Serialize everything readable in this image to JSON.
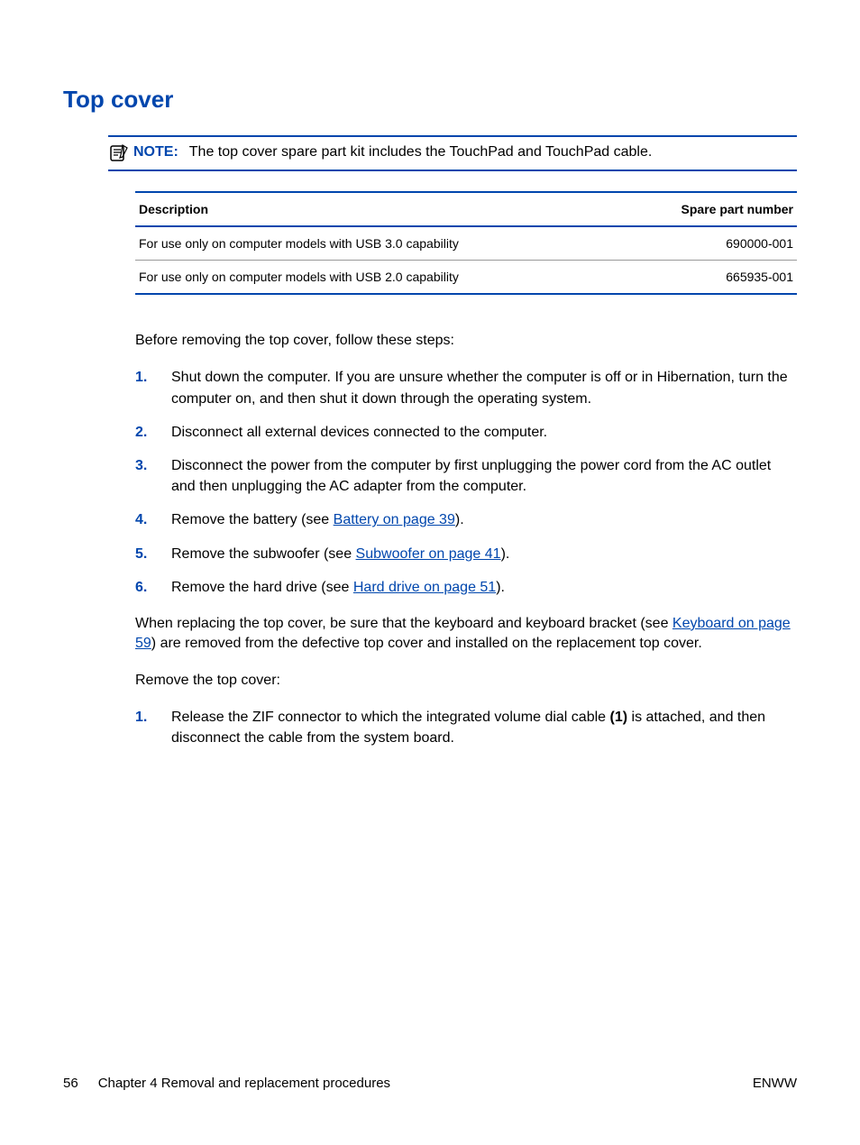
{
  "heading": "Top cover",
  "note": {
    "label": "NOTE:",
    "text": "The top cover spare part kit includes the TouchPad and TouchPad cable."
  },
  "table": {
    "headers": {
      "desc": "Description",
      "part": "Spare part number"
    },
    "rows": [
      {
        "desc": "For use only on computer models with USB 3.0 capability",
        "part": "690000-001"
      },
      {
        "desc": "For use only on computer models with USB 2.0 capability",
        "part": "665935-001"
      }
    ]
  },
  "intro": "Before removing the top cover, follow these steps:",
  "steps1": {
    "s1": "Shut down the computer. If you are unsure whether the computer is off or in Hibernation, turn the computer on, and then shut it down through the operating system.",
    "s2": "Disconnect all external devices connected to the computer.",
    "s3": "Disconnect the power from the computer by first unplugging the power cord from the AC outlet and then unplugging the AC adapter from the computer.",
    "s4_pre": "Remove the battery (see ",
    "s4_link": "Battery on page 39",
    "s4_post": ").",
    "s5_pre": "Remove the subwoofer (see ",
    "s5_link": "Subwoofer on page 41",
    "s5_post": ").",
    "s6_pre": "Remove the hard drive (see ",
    "s6_link": "Hard drive on page 51",
    "s6_post": ")."
  },
  "replace_para": {
    "pre": "When replacing the top cover, be sure that the keyboard and keyboard bracket (see ",
    "link": "Keyboard on page 59",
    "post": ") are removed from the defective top cover and installed on the replacement top cover."
  },
  "remove_intro": "Remove the top cover:",
  "steps2": {
    "s1_pre": "Release the ZIF connector to which the integrated volume dial cable ",
    "s1_bold": "(1)",
    "s1_post": " is attached, and then disconnect the cable from the system board."
  },
  "footer": {
    "page_num": "56",
    "chapter": "Chapter 4   Removal and replacement procedures",
    "right": "ENWW"
  }
}
